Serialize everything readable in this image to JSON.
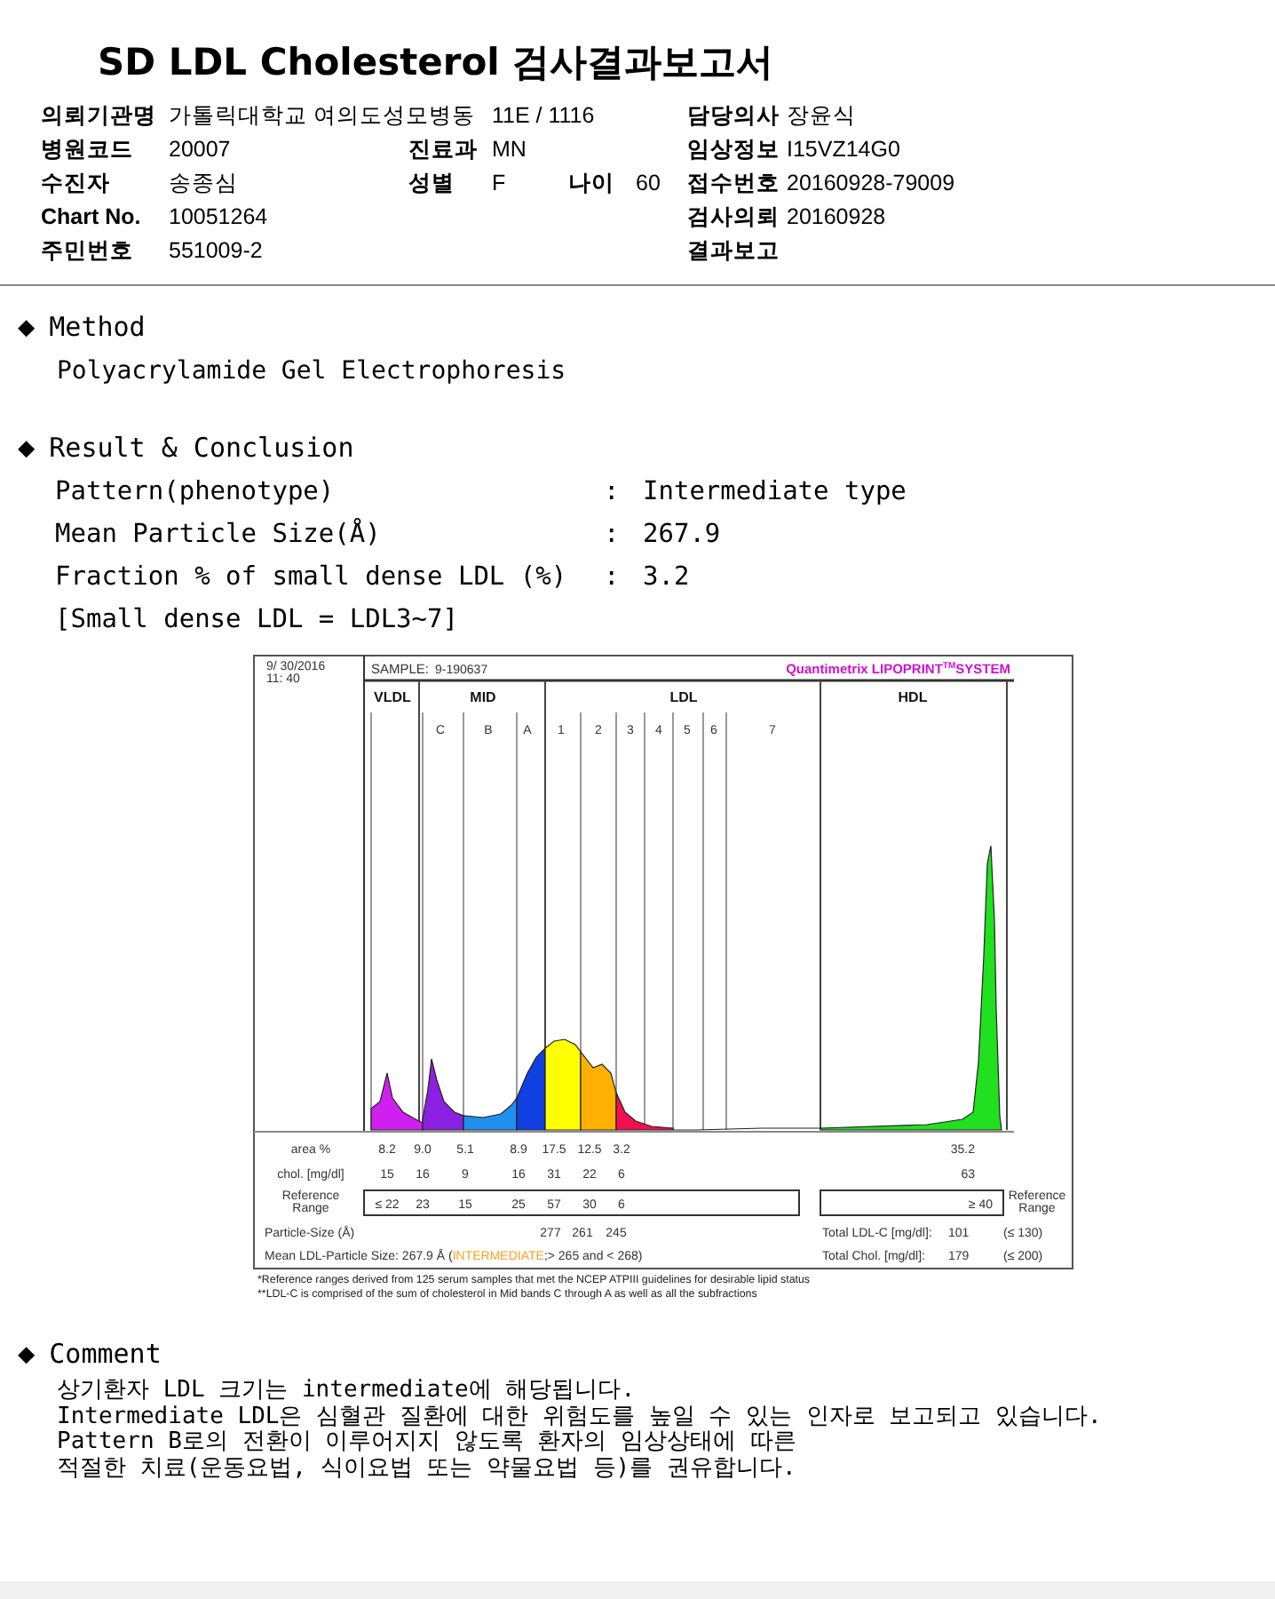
{
  "title": "SD LDL Cholesterol 검사결과보고서",
  "info_rows": [
    {
      "left": {
        "label": "의뢰기관명",
        "value": "가톨릭대학교 여의도성모병동"
      },
      "middle": [
        {
          "value": "11E / 1116"
        }
      ],
      "right": {
        "label": "담당의사",
        "value": "장윤식"
      }
    },
    {
      "left": {
        "label": "병원코드",
        "value": "20007"
      },
      "middle": [
        {
          "label": "진료과",
          "value": "MN"
        }
      ],
      "right": {
        "label": "임상정보",
        "value": "I15VZ14G0"
      }
    },
    {
      "left": {
        "label": "수진자",
        "value": "송종심"
      },
      "middle": [
        {
          "label": "성별",
          "value": "F"
        },
        {
          "label": "나이",
          "value": "60"
        }
      ],
      "right": {
        "label": "접수번호",
        "value": "20160928-79009"
      }
    },
    {
      "left": {
        "label": "Chart No.",
        "value": "10051264"
      },
      "right": {
        "label": "검사의뢰",
        "value": "20160928"
      }
    },
    {
      "left": {
        "label": "주민번호",
        "value": "551009-2"
      },
      "right": {
        "label": "결과보고"
      }
    }
  ],
  "sections": [
    {
      "kind": "text",
      "bullet": "◆",
      "heading": "Method",
      "lines": [
        "Polyacrylamide Gel Electrophoresis"
      ]
    },
    {
      "kind": "results",
      "bullet": "◆",
      "heading": "Result & Conclusion",
      "items": [
        {
          "label": "Pattern(phenotype)",
          "separator": ":",
          "value": "Intermediate type"
        },
        {
          "label": "Mean Particle Size(Å)",
          "separator": ":",
          "value": "267.9"
        },
        {
          "label": "Fraction % of small dense LDL (%)",
          "separator": ":",
          "value": "3.2"
        }
      ],
      "note": "[Small dense LDL = LDL3~7]",
      "lipoprint": {
        "date": "9/ 30/2016",
        "time": "11: 40",
        "sample_label": "SAMPLE:",
        "sample_id": "9-190637",
        "brand": "Quantimetrix LIPOPRINT",
        "brand_mark": "TM",
        "brand_suffix": "SYSTEM",
        "bands": [
          "VLDL",
          "MID",
          "LDL",
          "HDL"
        ],
        "subbands": [
          "C",
          "B",
          "A",
          "1",
          "2",
          "3",
          "4",
          "5",
          "6",
          "7"
        ],
        "rows": [
          {
            "label": "area %",
            "values": [
              "8.2",
              "9.0",
              "5.1",
              "8.9",
              "17.5",
              "12.5",
              "3.2"
            ],
            "hdl": "35.2"
          },
          {
            "label": "chol. [mg/dl]",
            "values": [
              "15",
              "16",
              "9",
              "16",
              "31",
              "22",
              "6"
            ],
            "hdl": "63"
          }
        ],
        "reference": {
          "label": [
            "Reference",
            "Range"
          ],
          "values": [
            "≤ 22",
            "23",
            "15",
            "25",
            "57",
            "30",
            "6"
          ],
          "hdl": "≥ 40",
          "side_label": [
            "Reference",
            "Range"
          ]
        },
        "particle_size": {
          "label": "Particle-Size (Å)",
          "values": [
            "277",
            "261",
            "245"
          ]
        },
        "totals": [
          {
            "label": "Total LDL-C [mg/dl]:",
            "value": "101",
            "limit": "(≤ 130)"
          },
          {
            "label": "Total Chol. [mg/dl]:",
            "value": "179",
            "limit": "(≤ 200)"
          }
        ],
        "mean_size": {
          "text": "Mean LDL-Particle Size:  267.9 Å  (",
          "category": "INTERMEDIATE",
          "rest": ";> 265 and < 268)"
        },
        "footnotes": [
          "*Reference ranges derived from 125 serum samples that met the NCEP ATPIII guidelines for desirable lipid status",
          "**LDL-C is comprised of the sum of cholesterol in Mid bands C through A as well as all the subfractions"
        ]
      }
    },
    {
      "kind": "text",
      "bullet": "◆",
      "heading": "Comment",
      "lines": [
        "상기환자 LDL 크기는 intermediate에 해당됩니다.",
        "Intermediate LDL은 심혈관 질환에 대한 위험도를 높일 수 있는 인자로 보고되고 있습니다.",
        "Pattern B로의 전환이 이루어지지 않도록 환자의 임상상태에 따른",
        "적절한 치료(운동요법, 식이요법 또는 약물요법 등)를 권유합니다."
      ]
    }
  ]
}
